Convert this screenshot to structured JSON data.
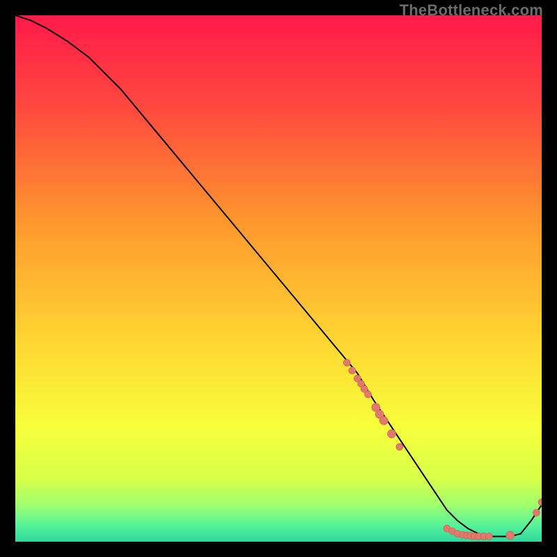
{
  "watermark": "TheBottleneck.com",
  "colors": {
    "bg_black": "#000000",
    "gradient_top": "#ff1a4a",
    "gradient_mid1": "#ff7a2e",
    "gradient_mid2": "#ffd633",
    "gradient_mid3": "#f2ff3a",
    "gradient_bottom1": "#9aff6e",
    "gradient_bottom2": "#37e6a0",
    "curve": "#000000",
    "dot_fill": "#e07a6e",
    "dot_stroke": "#d15c4f"
  },
  "chart_data": {
    "type": "line",
    "title": "",
    "xlabel": "",
    "ylabel": "",
    "xlim": [
      0,
      100
    ],
    "ylim": [
      0,
      100
    ],
    "series": [
      {
        "name": "bottleneck-curve",
        "x": [
          0,
          3,
          6,
          10,
          14,
          20,
          30,
          40,
          50,
          60,
          65,
          68,
          70,
          72,
          74,
          76,
          78,
          80,
          82,
          84,
          86,
          88,
          90,
          92,
          94,
          96,
          98,
          100
        ],
        "y": [
          100,
          99,
          97.5,
          95,
          92,
          86,
          74,
          62,
          50,
          38,
          32,
          27,
          24,
          21,
          18,
          15,
          12,
          9,
          6,
          4,
          2.5,
          1.5,
          1,
          1,
          1,
          1.5,
          4,
          7
        ]
      }
    ],
    "markers": [
      {
        "x": 63,
        "y": 34,
        "r": 5
      },
      {
        "x": 64,
        "y": 32.5,
        "r": 5
      },
      {
        "x": 65,
        "y": 31,
        "r": 5
      },
      {
        "x": 65.7,
        "y": 30,
        "r": 5
      },
      {
        "x": 66.3,
        "y": 29,
        "r": 5
      },
      {
        "x": 67,
        "y": 28,
        "r": 5
      },
      {
        "x": 68.5,
        "y": 25.5,
        "r": 6
      },
      {
        "x": 69.2,
        "y": 24.2,
        "r": 6
      },
      {
        "x": 70,
        "y": 23,
        "r": 6
      },
      {
        "x": 71.5,
        "y": 20.5,
        "r": 6
      },
      {
        "x": 73,
        "y": 18,
        "r": 5
      },
      {
        "x": 82,
        "y": 2.5,
        "r": 5
      },
      {
        "x": 83,
        "y": 2,
        "r": 5
      },
      {
        "x": 84,
        "y": 1.5,
        "r": 5
      },
      {
        "x": 85,
        "y": 1.3,
        "r": 5
      },
      {
        "x": 85.8,
        "y": 1.2,
        "r": 5
      },
      {
        "x": 86.5,
        "y": 1.1,
        "r": 5
      },
      {
        "x": 87.2,
        "y": 1.05,
        "r": 5
      },
      {
        "x": 88,
        "y": 1,
        "r": 5
      },
      {
        "x": 89,
        "y": 1,
        "r": 5
      },
      {
        "x": 90,
        "y": 1,
        "r": 5
      },
      {
        "x": 94,
        "y": 1.2,
        "r": 6
      },
      {
        "x": 99,
        "y": 5.5,
        "r": 5
      },
      {
        "x": 100,
        "y": 7.5,
        "r": 5
      }
    ]
  }
}
